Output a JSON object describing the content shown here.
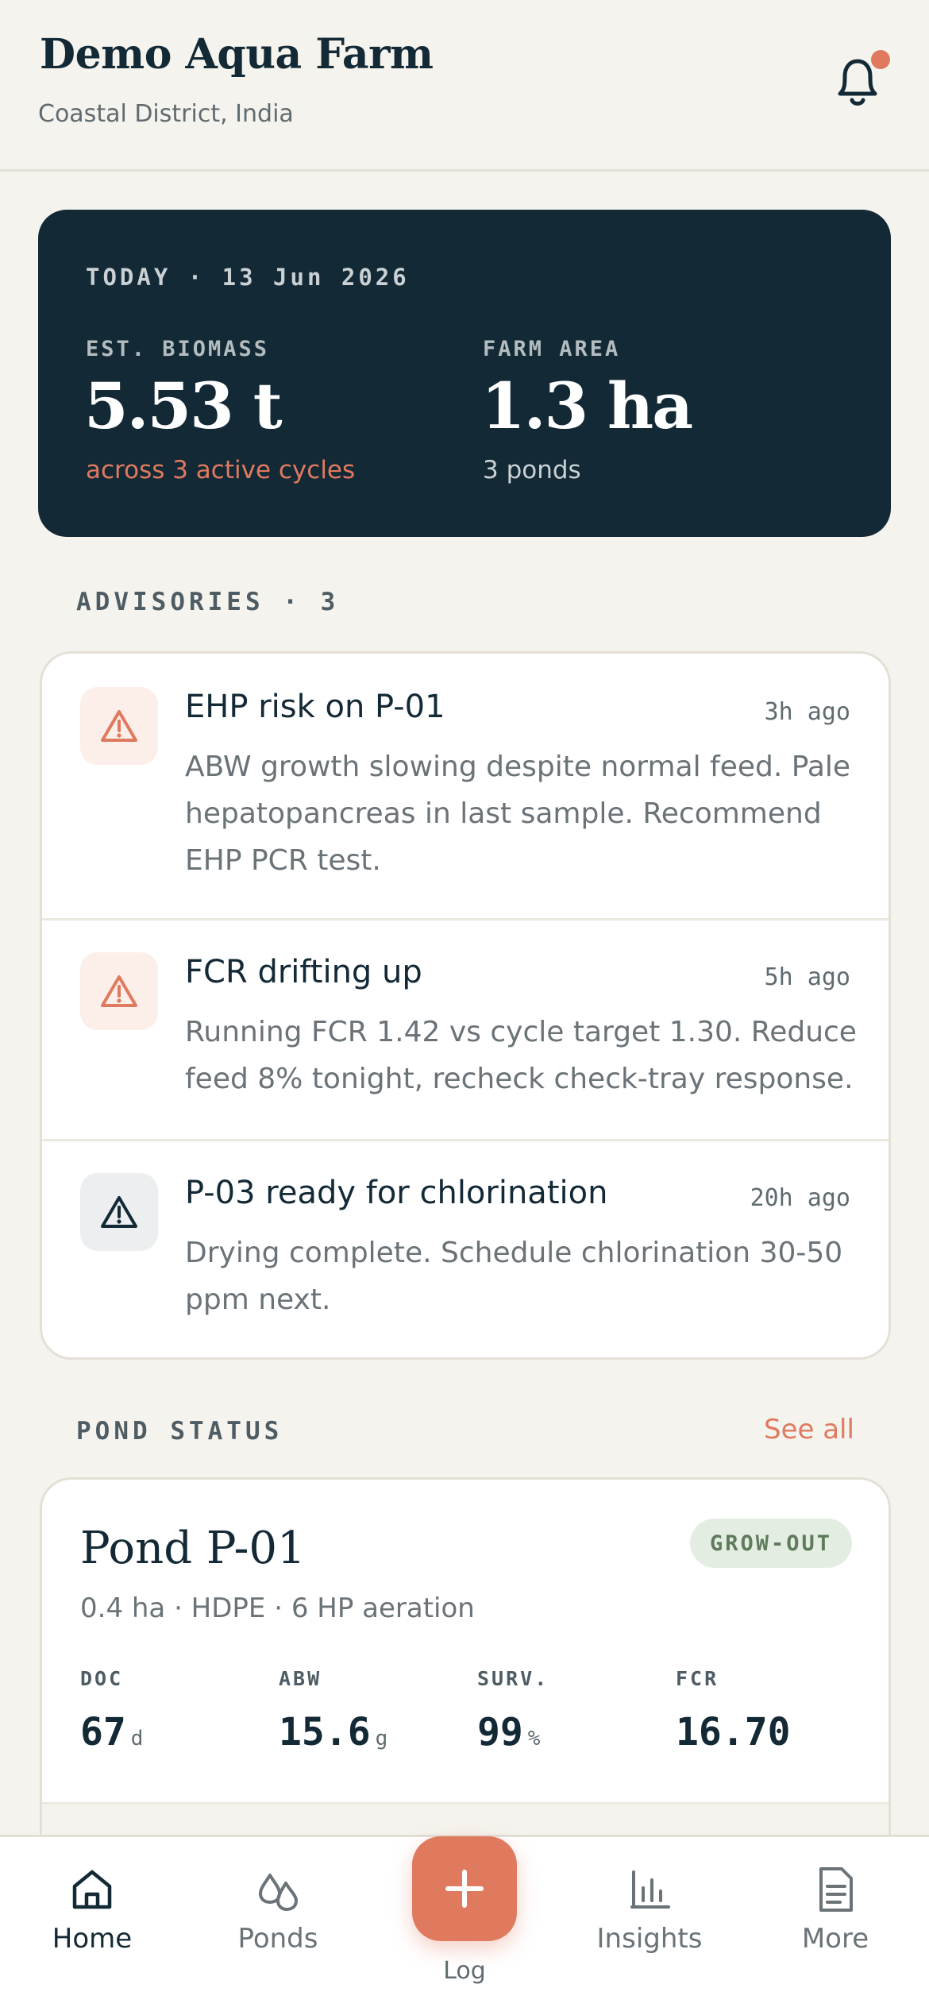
{
  "header": {
    "farm_name": "Demo Aqua Farm",
    "location": "Coastal District, India",
    "has_notification": true
  },
  "summary": {
    "date": "TODAY · 13 Jun 2026",
    "biomass_label": "EST. BIOMASS",
    "biomass_value": "5.53 t",
    "biomass_sub": "across 3 active cycles",
    "area_label": "FARM AREA",
    "area_value": "1.3 ha",
    "area_sub": "3 ponds"
  },
  "advisories": {
    "section_label": "ADVISORIES · 3",
    "items": [
      {
        "title": "EHP risk on P-01",
        "time": "3h ago",
        "body": "ABW growth slowing despite normal feed. Pale hepatopancreas in last sample. Recommend EHP PCR test.",
        "icon": "warning-triangle-icon",
        "severity": "warning"
      },
      {
        "title": "FCR drifting up",
        "time": "5h ago",
        "body": "Running FCR 1.42 vs cycle target 1.30. Reduce feed 8% tonight, recheck check-tray response.",
        "icon": "warning-triangle-icon",
        "severity": "warning"
      },
      {
        "title": "P-03 ready for chlorination",
        "time": "20h ago",
        "body": "Drying complete. Schedule chlorination 30-50 ppm next.",
        "icon": "warning-triangle-icon",
        "severity": "info"
      }
    ]
  },
  "pond_status": {
    "section_label": "POND STATUS",
    "see_all": "See all",
    "pond": {
      "name": "Pond P-01",
      "badge": "GROW-OUT",
      "meta": "0.4 ha · HDPE · 6 HP aeration",
      "metrics": [
        {
          "label": "DOC",
          "value": "67",
          "unit": "d"
        },
        {
          "label": "ABW",
          "value": "15.6",
          "unit": "g"
        },
        {
          "label": "SURV.",
          "value": "99",
          "unit": "%"
        },
        {
          "label": "FCR",
          "value": "16.70",
          "unit": ""
        }
      ]
    }
  },
  "nav": {
    "items": [
      {
        "label": "Home",
        "icon": "home-icon",
        "active": true
      },
      {
        "label": "Ponds",
        "icon": "droplets-icon",
        "active": false
      },
      {
        "label": "Insights",
        "icon": "bar-chart-icon",
        "active": false
      },
      {
        "label": "More",
        "icon": "document-icon",
        "active": false
      }
    ],
    "fab_label": "Log",
    "fab_icon": "plus-icon"
  },
  "colors": {
    "accent": "#E07A5F",
    "navy": "#132A36",
    "background": "#F5F3EE",
    "badge_bg": "#E3EDE2",
    "badge_text": "#5E7B5C"
  }
}
